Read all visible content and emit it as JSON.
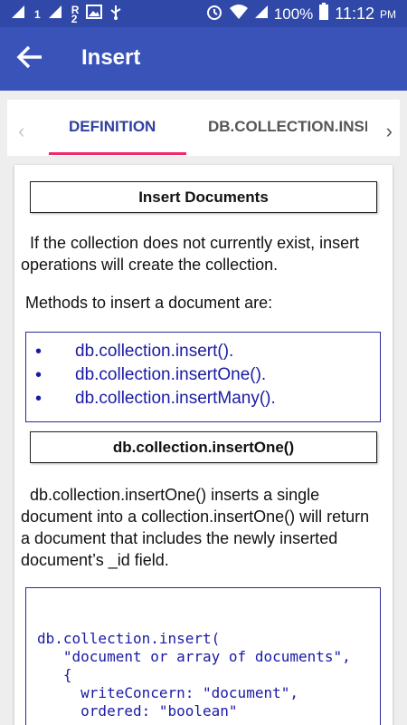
{
  "status_bar": {
    "sim_label_1": "1",
    "sim_label_r": "R",
    "sim_label_2": "2",
    "battery": "100%",
    "time": "11:12",
    "ampm": "PM",
    "icons": [
      "signal-icon",
      "image-icon",
      "usb-icon",
      "alarm-icon",
      "wifi-icon",
      "cell-signal-icon",
      "battery-icon"
    ]
  },
  "app_bar": {
    "title": "Insert",
    "background": "#3a53b9"
  },
  "tabs": {
    "items": [
      {
        "label": "DEFINITION",
        "selected": true
      },
      {
        "label": "DB.COLLECTION.INSE",
        "selected": false
      }
    ],
    "indicator_color": "#ee2a6e"
  },
  "content": {
    "heading_1": "Insert Documents",
    "para_1": "If the collection does not currently exist, insert operations will create the collection.",
    "para_2": "Methods to insert a document are:",
    "methods": [
      "db.collection.insert().",
      "db.collection.insertOne().",
      "db.collection.insertMany()."
    ],
    "heading_2": "db.collection.insertOne()",
    "para_3": "db.collection.insertOne() inserts a single document into a collection.insertOne() will return a document that includes the newly inserted document’s _id field.",
    "code": "db.collection.insert(\n   \"document or array of documents\",\n   {\n     writeConcern: \"document\",\n     ordered: \"boolean\""
  }
}
